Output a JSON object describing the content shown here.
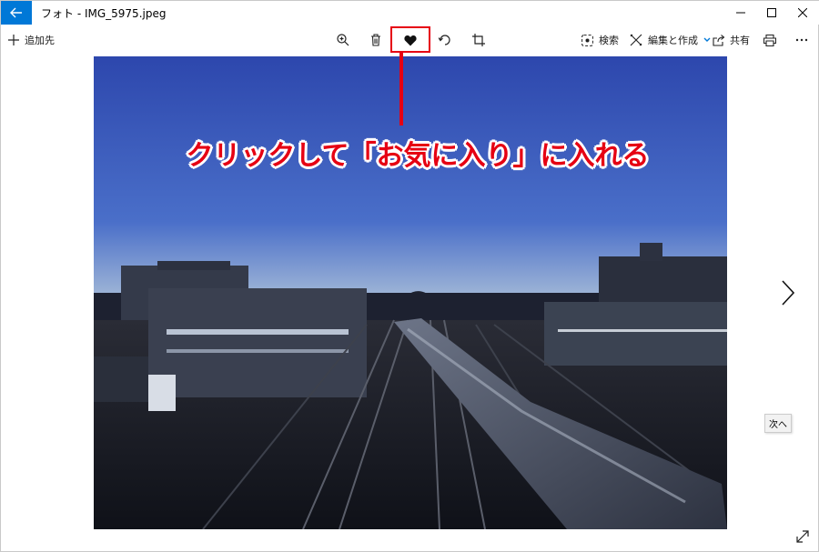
{
  "window": {
    "title": "フォト - IMG_5975.jpeg",
    "accent_color": "#0078d7"
  },
  "toolbar": {
    "add_to_label": "追加先",
    "search_label": "検索",
    "edit_create_label": "編集と作成",
    "share_label": "共有",
    "icons": [
      "add-icon",
      "zoom-icon",
      "delete-icon",
      "heart-icon",
      "rotate-icon",
      "crop-icon",
      "search-icon",
      "edit-icon",
      "share-icon",
      "print-icon",
      "more-icon"
    ]
  },
  "annotation": {
    "text": "クリックして「お気に入り」に入れる",
    "color": "#e60012"
  },
  "navigation": {
    "next_tooltip": "次へ"
  }
}
